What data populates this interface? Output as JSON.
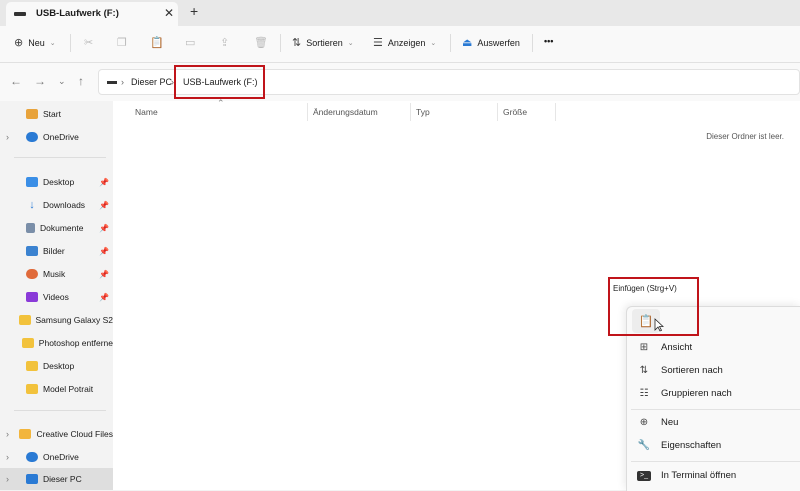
{
  "tab": {
    "title": "USB-Laufwerk (F:)",
    "close": "✕",
    "new_tab": "+"
  },
  "toolbar": {
    "new_label": "Neu",
    "sort_label": "Sortieren",
    "view_label": "Anzeigen",
    "eject_label": "Auswerfen",
    "more_label": "•••"
  },
  "address": {
    "pc": "Dieser PC",
    "drive": "USB-Laufwerk (F:)",
    "separator": "›"
  },
  "sidebar": {
    "items": [
      {
        "label": "Start",
        "color": "#e8a33b"
      },
      {
        "label": "OneDrive",
        "color": "#2a7ad4"
      },
      {
        "label": "Desktop",
        "color": "#3a8ee6"
      },
      {
        "label": "Downloads",
        "color": "#2a7ad4"
      },
      {
        "label": "Dokumente",
        "color": "#7a8ea8"
      },
      {
        "label": "Bilder",
        "color": "#3b82d0"
      },
      {
        "label": "Musik",
        "color": "#e06a3a"
      },
      {
        "label": "Videos",
        "color": "#8a3ad8"
      },
      {
        "label": "Samsung Galaxy S2",
        "color": "#f2c23c"
      },
      {
        "label": "Photoshop entferne",
        "color": "#f2c23c"
      },
      {
        "label": "Desktop",
        "color": "#f2c23c"
      },
      {
        "label": "Model Potrait",
        "color": "#f2c23c"
      },
      {
        "label": "Creative Cloud Files",
        "color": "#f2b53c"
      },
      {
        "label": "OneDrive",
        "color": "#2a7ad4"
      },
      {
        "label": "Dieser PC",
        "color": "#2a7ad4"
      }
    ]
  },
  "columns": {
    "name": "Name",
    "date": "Änderungsdatum",
    "type": "Typ",
    "size": "Größe"
  },
  "empty_text": "Dieser Ordner ist leer.",
  "context_menu": {
    "tooltip": "Einfügen (Strg+V)",
    "items": [
      {
        "label": "Ansicht",
        "icon": "grid-icon"
      },
      {
        "label": "Sortieren nach",
        "icon": "sort-icon"
      },
      {
        "label": "Gruppieren nach",
        "icon": "group-icon"
      },
      {
        "label": "Neu",
        "icon": "plus-circle-icon"
      },
      {
        "label": "Eigenschaften",
        "icon": "wrench-icon"
      },
      {
        "label": "In Terminal öffnen",
        "icon": "terminal-icon"
      }
    ]
  },
  "highlight_color": "#c0141a"
}
